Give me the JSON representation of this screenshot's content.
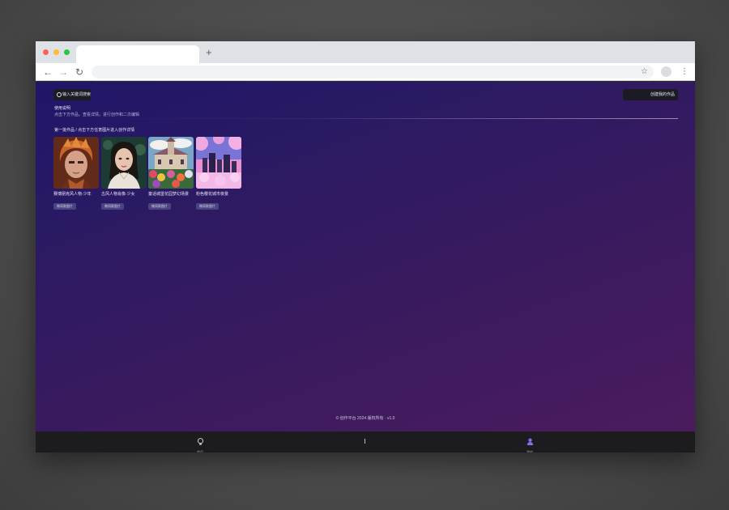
{
  "browser": {
    "new_tab_label": "+",
    "back": "←",
    "forward": "→",
    "reload": "↻",
    "star": "☆",
    "menu": "⋮"
  },
  "page": {
    "search_button_label": "输入关键词搜索",
    "right_button_label": "创建我的作品",
    "intro_title": "使用说明",
    "intro_desc": "点击下方作品，查看详情，进行创作和二次编辑",
    "section_label": "第一批作品 / 点击下方任意图片进入创作详情",
    "footer_text": "© 创作平台 2024 版权所有 · v1.0"
  },
  "cards": [
    {
      "caption": "赛博朋克风人物·少年",
      "chip": "做同款图片"
    },
    {
      "caption": "古风人物肖像·少女",
      "chip": "做同款图片"
    },
    {
      "caption": "童话城堡花园梦幻场景",
      "chip": "做同款图片"
    },
    {
      "caption": "粉色樱花城市夜景",
      "chip": "做同款图片"
    }
  ],
  "bottom_nav": {
    "home_label": "首页",
    "me_label": "我的"
  },
  "colors": {
    "accent": "#6d4fd8",
    "gradient_start": "#1f1668",
    "gradient_end": "#4a1c5e"
  }
}
